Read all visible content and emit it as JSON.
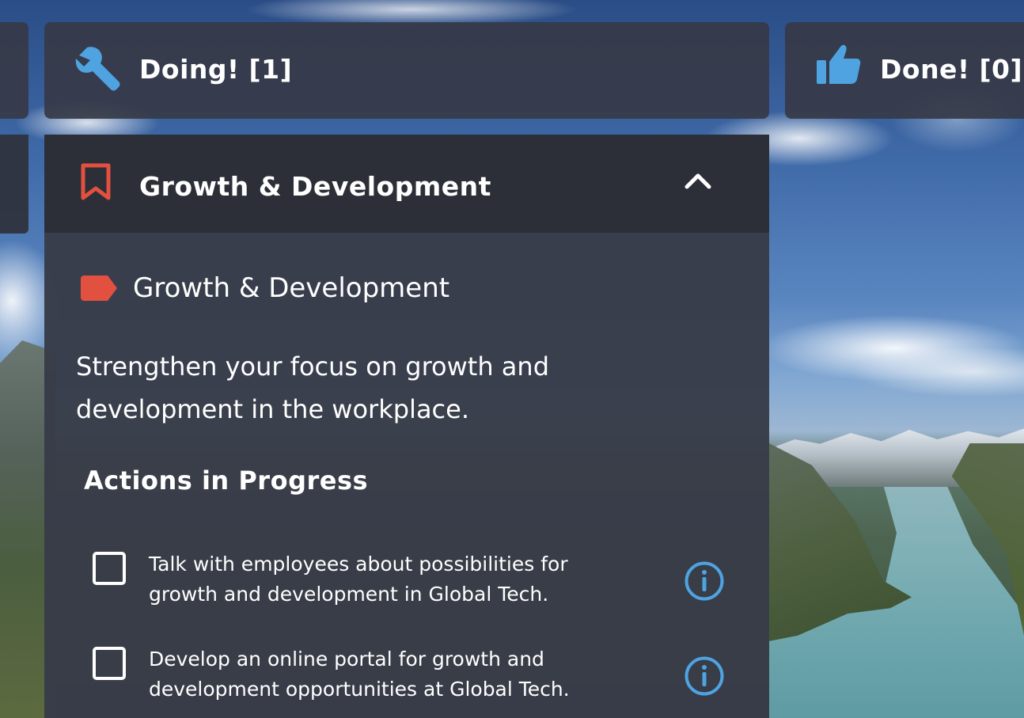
{
  "columns": {
    "doing": {
      "title": "Doing! [1]",
      "icon": "wrench-icon"
    },
    "done": {
      "title": "Done! [0]",
      "icon": "thumbs-up-icon"
    }
  },
  "category": {
    "title": "Growth & Development",
    "icon": "bookmark-icon",
    "collapse_icon": "chevron-up-icon",
    "tag": {
      "label": "Growth & Development",
      "icon": "tag-icon"
    },
    "description": "Strengthen your focus on growth and development in the workplace.",
    "section_heading": "Actions in Progress",
    "actions": [
      {
        "text": "Talk with employees about possibilities for growth and development in Global Tech.",
        "checked": false,
        "info_icon": "info-icon"
      },
      {
        "text": "Develop an online portal for growth and development opportunities at Global Tech.",
        "checked": false,
        "info_icon": "info-icon"
      }
    ]
  },
  "colors": {
    "accent_blue": "#4ea3e0",
    "accent_red": "#e2503f",
    "panel": "#383c48",
    "panel_header": "#2c2f38"
  }
}
